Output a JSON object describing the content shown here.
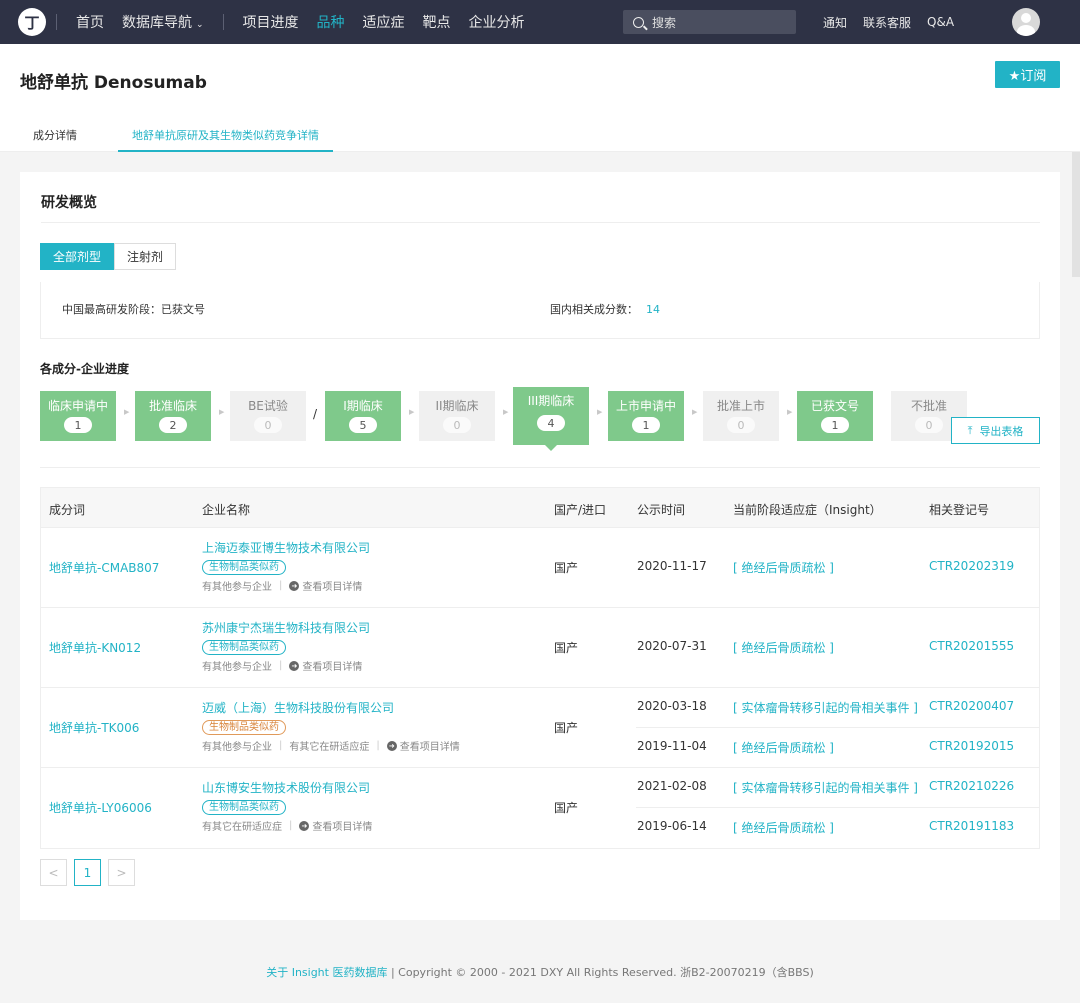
{
  "nav": {
    "logo": "丁",
    "items": [
      "首页",
      "数据库导航",
      "项目进度",
      "品种",
      "适应症",
      "靶点",
      "企业分析"
    ],
    "search_placeholder": "搜索",
    "right_links": [
      "通知",
      "联系客服",
      "Q&A"
    ]
  },
  "header": {
    "title": "地舒单抗 Denosumab",
    "subscribe": "★订阅",
    "tabs": [
      "成分详情",
      "地舒单抗原研及其生物类似药竞争详情"
    ]
  },
  "overview": {
    "title": "研发概览",
    "filters": [
      "全部剂型",
      "注射剂"
    ],
    "highest_stage_label": "中国最高研发阶段：已获文号",
    "count_label": "国内相关成分数：",
    "count_value": "14",
    "progress_title": "各成分-企业进度",
    "stages": [
      {
        "label": "临床申请中",
        "count": "1"
      },
      {
        "label": "批准临床",
        "count": "2"
      },
      {
        "label": "BE试验",
        "count": "0"
      },
      {
        "label": "I期临床",
        "count": "5"
      },
      {
        "label": "II期临床",
        "count": "0"
      },
      {
        "label": "III期临床",
        "count": "4"
      },
      {
        "label": "上市申请中",
        "count": "1"
      },
      {
        "label": "批准上市",
        "count": "0"
      },
      {
        "label": "已获文号",
        "count": "1"
      },
      {
        "label": "不批准",
        "count": "0"
      }
    ],
    "slash": "/",
    "export": "导出表格"
  },
  "table": {
    "headers": [
      "成分词",
      "企业名称",
      "国产/进口",
      "公示时间",
      "当前阶段适应症（Insight）",
      "相关登记号"
    ],
    "link_other_companies": "有其他参与企业",
    "link_other_indications": "有其它在研适应症",
    "link_project": "查看项目详情",
    "rows": [
      {
        "name": "地舒单抗-CMAB807",
        "company": "上海迈泰亚博生物技术有限公司",
        "tag": "生物制品类似药",
        "origin": "国产",
        "entries": [
          {
            "date": "2020-11-17",
            "indication": "[ 绝经后骨质疏松 ]",
            "reg": "CTR20202319"
          }
        ]
      },
      {
        "name": "地舒单抗-KN012",
        "company": "苏州康宁杰瑞生物科技有限公司",
        "tag": "生物制品类似药",
        "origin": "国产",
        "entries": [
          {
            "date": "2020-07-31",
            "indication": "[ 绝经后骨质疏松 ]",
            "reg": "CTR20201555"
          }
        ]
      },
      {
        "name": "地舒单抗-TK006",
        "company": "迈威（上海）生物科技股份有限公司",
        "tag": "生物制品类似药",
        "origin": "国产",
        "entries": [
          {
            "date": "2020-03-18",
            "indication": "[ 实体瘤骨转移引起的骨相关事件 ]",
            "reg": "CTR20200407"
          },
          {
            "date": "2019-11-04",
            "indication": "[ 绝经后骨质疏松 ]",
            "reg": "CTR20192015"
          }
        ]
      },
      {
        "name": "地舒单抗-LY06006",
        "company": "山东博安生物技术股份有限公司",
        "tag": "生物制品类似药",
        "origin": "国产",
        "entries": [
          {
            "date": "2021-02-08",
            "indication": "[ 实体瘤骨转移引起的骨相关事件 ]",
            "reg": "CTR20210226"
          },
          {
            "date": "2019-06-14",
            "indication": "[ 绝经后骨质疏松 ]",
            "reg": "CTR20191183"
          }
        ]
      }
    ]
  },
  "pagination": {
    "prev": "<",
    "current": "1",
    "next": ">"
  },
  "footer": {
    "about": "关于 Insight 医药数据库",
    "copyright": " | Copyright © 2000 - 2021 DXY All Rights Reserved. 浙B2-20070219（含BBS)"
  },
  "colors": {
    "accent": "#22b3c6",
    "stage_active": "#7fc98b",
    "nav_bg": "#2e3245",
    "tag_orange": "#d8843a"
  }
}
